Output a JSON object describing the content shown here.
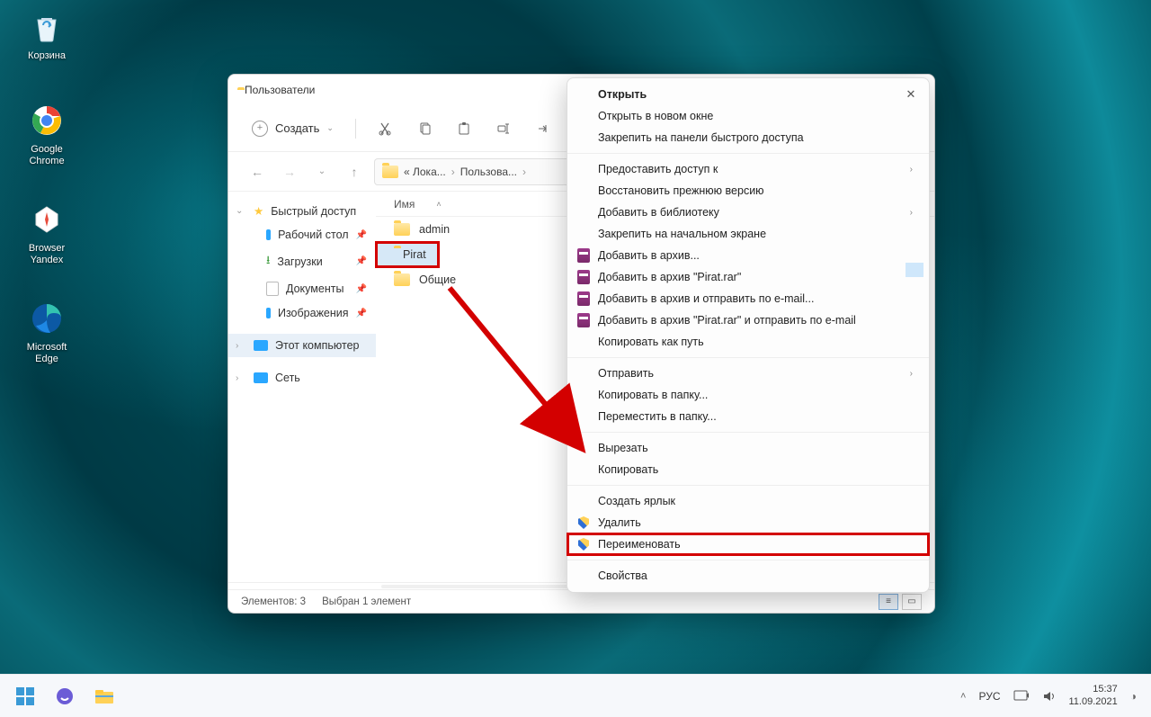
{
  "desktop_icons": [
    {
      "label": "Корзина",
      "name": "recycle-bin"
    },
    {
      "label": "Google\nChrome",
      "name": "google-chrome"
    },
    {
      "label": "Browser\nYandex",
      "name": "yandex-browser"
    },
    {
      "label": "Microsoft\nEdge",
      "name": "microsoft-edge"
    }
  ],
  "explorer": {
    "title": "Пользователи",
    "toolbar": {
      "create_label": "Создать"
    },
    "breadcrumb": {
      "part1": "« Лока...",
      "part2": "Пользова..."
    },
    "columns": {
      "name": "Имя"
    },
    "sidebar": {
      "quick": "Быстрый доступ",
      "desktop": "Рабочий стол",
      "downloads": "Загрузки",
      "documents": "Документы",
      "images": "Изображения",
      "this_pc": "Этот компьютер",
      "network": "Сеть"
    },
    "files": {
      "admin": "admin",
      "pirat": "Pirat",
      "public": "Общие"
    },
    "statusbar": {
      "count": "Элементов: 3",
      "selected": "Выбран 1 элемент"
    }
  },
  "context_menu": {
    "open": "Открыть",
    "open_new": "Открыть в новом окне",
    "pin_quick": "Закрепить на панели быстрого доступа",
    "share_access": "Предоставить доступ к",
    "restore_prev": "Восстановить прежнюю версию",
    "add_library": "Добавить в библиотеку",
    "pin_start": "Закрепить на начальном экране",
    "add_archive": "Добавить в архив...",
    "add_archive_rar": "Добавить в архив \"Pirat.rar\"",
    "add_archive_email": "Добавить в архив и отправить по e-mail...",
    "add_archive_rar_email": "Добавить в архив \"Pirat.rar\" и отправить по e-mail",
    "copy_path": "Копировать как путь",
    "send_to": "Отправить",
    "copy_to_folder": "Копировать в папку...",
    "move_to_folder": "Переместить в папку...",
    "cut": "Вырезать",
    "copy": "Копировать",
    "create_shortcut": "Создать ярлык",
    "delete": "Удалить",
    "rename": "Переименовать",
    "properties": "Свойства"
  },
  "taskbar": {
    "lang": "РУС",
    "time": "15:37",
    "date": "11.09.2021"
  }
}
